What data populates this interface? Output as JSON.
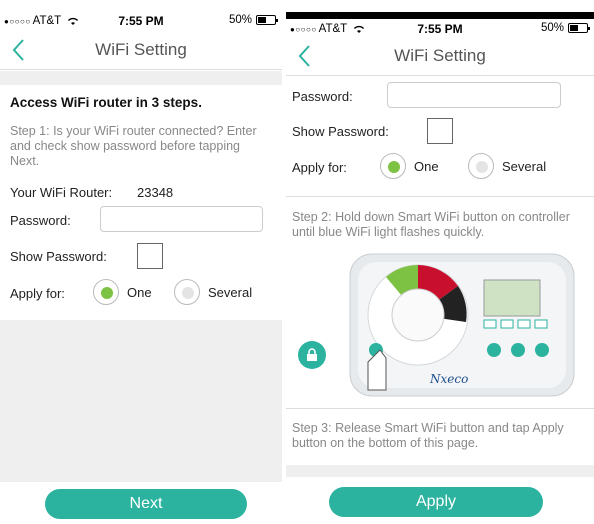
{
  "status": {
    "carrier": "AT&T",
    "time": "7:55 PM",
    "battery": "50%"
  },
  "nav": {
    "title": "WiFi Setting"
  },
  "left": {
    "heading": "Access WiFi router in 3 steps.",
    "step1": "Step 1: Is your WiFi router connected? Enter and check show password before tapping Next.",
    "router_label": "Your WiFi Router:",
    "router_name": "23348",
    "password_label": "Password:",
    "password_value": "",
    "show_password_label": "Show Password:",
    "show_password_checked": false,
    "apply_for_label": "Apply for:",
    "apply_options": [
      "One",
      "Several"
    ],
    "apply_selected": "One",
    "next_button": "Next"
  },
  "right": {
    "password_label": "Password:",
    "password_value": "",
    "show_password_label": "Show Password:",
    "show_password_checked": false,
    "apply_for_label": "Apply for:",
    "apply_options": [
      "One",
      "Several"
    ],
    "apply_selected": "One",
    "step2": "Step 2: Hold down Smart WiFi button on controller until blue WiFi light flashes quickly.",
    "step3": "Step 3: Release Smart WiFi button and tap Apply button on the bottom of this page.",
    "controller_brand": "Nxeco",
    "apply_button": "Apply"
  },
  "colors": {
    "accent": "#2bb3a0",
    "radio_selected": "#7dc242",
    "background_gray": "#efeff0"
  }
}
